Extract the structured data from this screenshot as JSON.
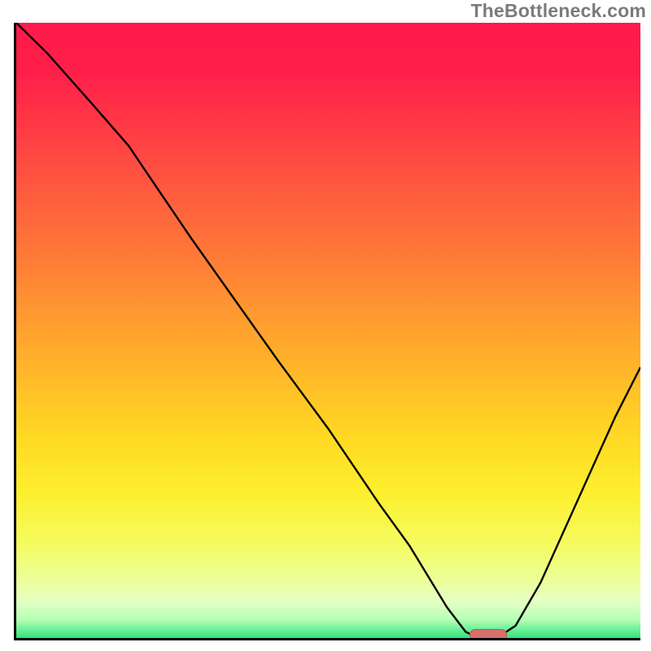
{
  "watermark": "TheBottleneck.com",
  "colors": {
    "gradient_top": "#ff1a4b",
    "gradient_mid": "#ffd823",
    "gradient_bottom": "#2fe37d",
    "curve": "#000000",
    "marker": "#d66f6c",
    "axes": "#000000"
  },
  "chart_data": {
    "type": "line",
    "title": "",
    "xlabel": "",
    "ylabel": "",
    "xlim": [
      0,
      100
    ],
    "ylim": [
      0,
      100
    ],
    "x": [
      0,
      5,
      12,
      18,
      22,
      28,
      35,
      42,
      50,
      58,
      63,
      66,
      69,
      72,
      74,
      77,
      80,
      84,
      88,
      92,
      96,
      100
    ],
    "values": [
      100,
      95,
      87,
      80,
      74,
      65,
      55,
      45,
      34,
      22,
      15,
      10,
      5,
      1,
      0,
      0,
      2,
      9,
      18,
      27,
      36,
      44
    ],
    "minimum_marker": {
      "x": 75.5,
      "y": 0
    },
    "annotations": []
  }
}
